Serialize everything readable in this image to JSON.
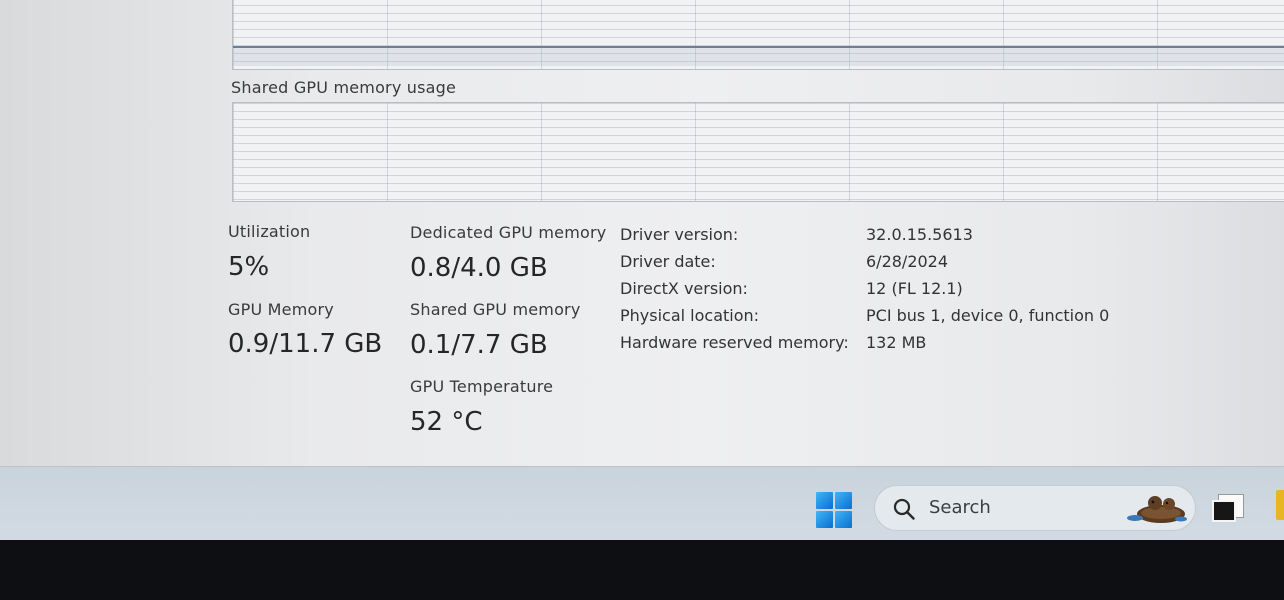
{
  "graphs": {
    "shared_memory_title": "Shared GPU memory usage"
  },
  "stats": {
    "utilization": {
      "label": "Utilization",
      "value": "5%"
    },
    "gpu_memory": {
      "label": "GPU Memory",
      "value": "0.9/11.7 GB"
    },
    "dedicated_memory": {
      "label": "Dedicated GPU memory",
      "value": "0.8/4.0 GB"
    },
    "shared_memory": {
      "label": "Shared GPU memory",
      "value": "0.1/7.7 GB"
    },
    "temperature": {
      "label": "GPU Temperature",
      "value": "52 °C"
    }
  },
  "properties": [
    {
      "key": "Driver version:",
      "value": "32.0.15.5613"
    },
    {
      "key": "Driver date:",
      "value": "6/28/2024"
    },
    {
      "key": "DirectX version:",
      "value": "12 (FL 12.1)"
    },
    {
      "key": "Physical location:",
      "value": "PCI bus 1, device 0, function 0"
    },
    {
      "key": "Hardware reserved memory:",
      "value": "132 MB"
    }
  ],
  "taskbar": {
    "search_label": "Search",
    "icons": [
      "windows-start-icon",
      "search-icon",
      "otter-widget-icon",
      "task-view-icon",
      "file-explorer-icon"
    ]
  },
  "colors": {
    "graph_line": "#6d7d9a",
    "start_blue": "#0a6fd0",
    "taskbar_bg": "#ccd6df"
  }
}
